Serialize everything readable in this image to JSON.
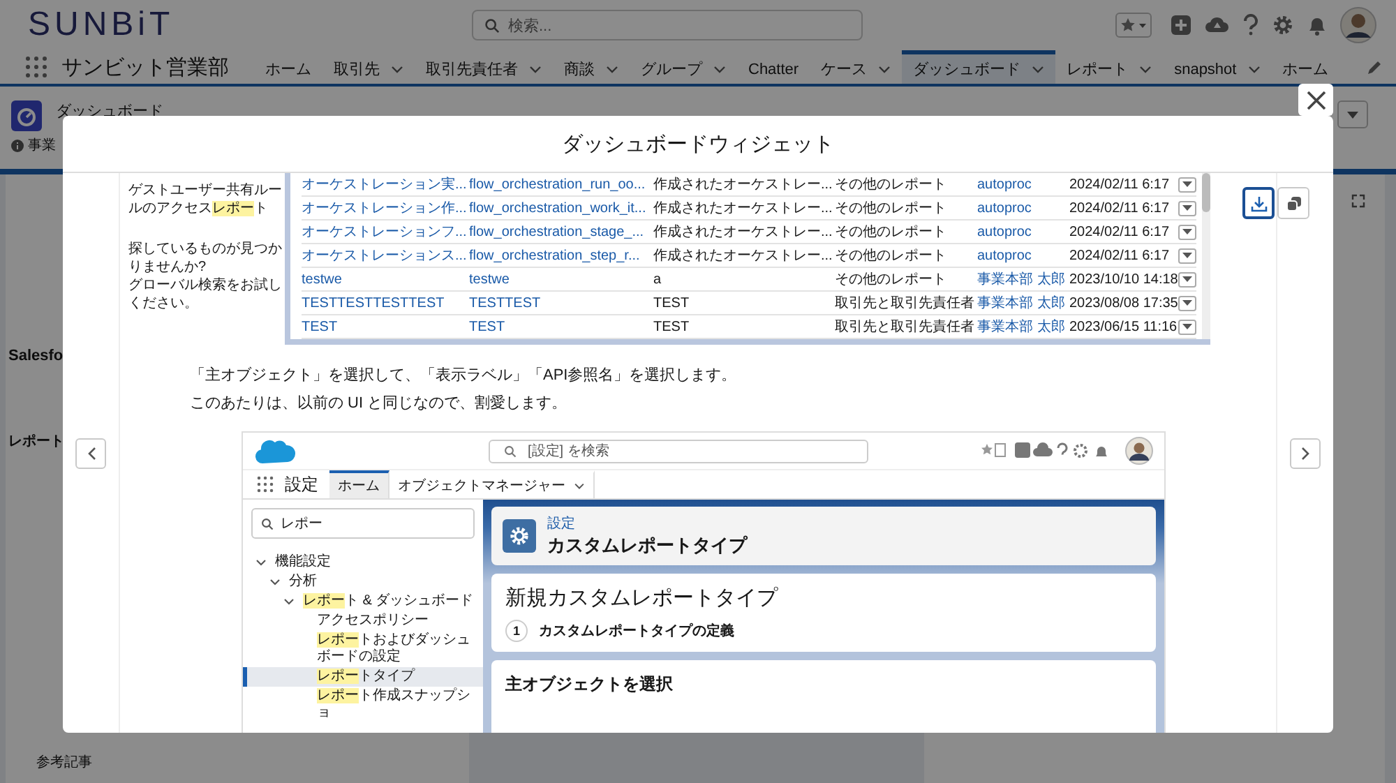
{
  "header": {
    "logo": "SUNBiT",
    "search_placeholder": "検索...",
    "app_name": "サンビット営業部",
    "nav": [
      {
        "label": "ホーム",
        "has_menu": false,
        "selected": false
      },
      {
        "label": "取引先",
        "has_menu": true,
        "selected": false
      },
      {
        "label": "取引先責任者",
        "has_menu": true,
        "selected": false
      },
      {
        "label": "商談",
        "has_menu": true,
        "selected": false
      },
      {
        "label": "グループ",
        "has_menu": true,
        "selected": false
      },
      {
        "label": "Chatter",
        "has_menu": false,
        "selected": false
      },
      {
        "label": "ケース",
        "has_menu": true,
        "selected": false
      },
      {
        "label": "ダッシュボード",
        "has_menu": true,
        "selected": true
      },
      {
        "label": "レポート",
        "has_menu": true,
        "selected": false
      },
      {
        "label": "snapshot",
        "has_menu": true,
        "selected": false
      },
      {
        "label": "ホーム",
        "has_menu": false,
        "selected": false
      }
    ]
  },
  "page": {
    "object_label": "ダッシュボード",
    "owner": "事業",
    "article_heading": "Salesfo",
    "section_heading": "レポート",
    "related_heading": "参考記事"
  },
  "modal": {
    "title": "ダッシュボードウィジェット",
    "tools": [
      {
        "kind": "download",
        "selected": true
      },
      {
        "kind": "copy",
        "selected": false
      }
    ],
    "article": {
      "sidebar_link": [
        {
          "text": "ゲストユーザー共有ルールのアクセス",
          "highlight": false
        },
        {
          "text": "レポー",
          "highlight": true
        },
        {
          "text": "ト",
          "highlight": false
        }
      ],
      "help_lines": [
        "探しているものが見つかりませんか?",
        "グローバル検索をお試しください。"
      ],
      "rows": [
        {
          "name": "オーケストレーション実...",
          "api_name": "flow_orchestration_run_oo...",
          "description": "作成されたオーケストレー...",
          "category": "その他のレポート",
          "creator": "autoproc",
          "date": "2024/02/11 6:17"
        },
        {
          "name": "オーケストレーション作...",
          "api_name": "flow_orchestration_work_it...",
          "description": "作成されたオーケストレー...",
          "category": "その他のレポート",
          "creator": "autoproc",
          "date": "2024/02/11 6:17"
        },
        {
          "name": "オーケストレーションフ...",
          "api_name": "flow_orchestration_stage_...",
          "description": "作成されたオーケストレー...",
          "category": "その他のレポート",
          "creator": "autoproc",
          "date": "2024/02/11 6:17"
        },
        {
          "name": "オーケストレーションス...",
          "api_name": "flow_orchestration_step_r...",
          "description": "作成されたオーケストレー...",
          "category": "その他のレポート",
          "creator": "autoproc",
          "date": "2024/02/11 6:17"
        },
        {
          "name": "testwe",
          "api_name": "testwe",
          "description": "a",
          "category": "その他のレポート",
          "creator": "事業本部 太郎",
          "date": "2023/10/10 14:18"
        },
        {
          "name": "TESTTESTTESTTEST",
          "api_name": "TESTTEST",
          "description": "TEST",
          "category": "取引先と取引先責任者",
          "creator": "事業本部 太郎",
          "date": "2023/08/08 17:35"
        },
        {
          "name": "TEST",
          "api_name": "TEST",
          "description": "TEST",
          "category": "取引先と取引先責任者",
          "creator": "事業本部 太郎",
          "date": "2023/06/15 11:16"
        }
      ],
      "paragraph": [
        "「主オブジェクト」を選択して、「表示ラベル」「API参照名」を選択します。",
        "このあたりは、以前の UI と同じなので、割愛します。"
      ],
      "embedded": {
        "search_placeholder": "[設定] を検索",
        "app_name": "設定",
        "tabs": [
          {
            "label": "ホーム",
            "has_menu": false,
            "selected": true
          },
          {
            "label": "オブジェクトマネージャー",
            "has_menu": true,
            "selected": false
          }
        ],
        "quick_find": "レポー",
        "tree": [
          {
            "segments": [
              {
                "text": "機能設定",
                "highlight": false
              }
            ],
            "expanded": true,
            "selected": false,
            "children": [
              {
                "segments": [
                  {
                    "text": "分析",
                    "highlight": false
                  }
                ],
                "expanded": true,
                "selected": false,
                "children": [
                  {
                    "segments": [
                      {
                        "text": "レポー",
                        "highlight": true
                      },
                      {
                        "text": "ト & ダッシュボード",
                        "highlight": false
                      }
                    ],
                    "expanded": true,
                    "selected": false,
                    "children": [
                      {
                        "segments": [
                          {
                            "text": "アクセスポリシー",
                            "highlight": false
                          }
                        ],
                        "selected": false
                      },
                      {
                        "segments": [
                          {
                            "text": "レポー",
                            "highlight": true
                          },
                          {
                            "text": "トおよびダッシュボードの設定",
                            "highlight": false
                          }
                        ],
                        "selected": false
                      },
                      {
                        "segments": [
                          {
                            "text": "レポー",
                            "highlight": true
                          },
                          {
                            "text": "トタイプ",
                            "highlight": false
                          }
                        ],
                        "selected": true
                      },
                      {
                        "segments": [
                          {
                            "text": "レポー",
                            "highlight": true
                          },
                          {
                            "text": "ト作成スナップショ",
                            "highlight": false
                          }
                        ],
                        "selected": false
                      }
                    ]
                  }
                ]
              }
            ]
          }
        ],
        "header_card": {
          "eyebrow": "設定",
          "title": "カスタムレポートタイプ"
        },
        "wizard": {
          "title": "新規カスタムレポートタイプ",
          "step_number": "1",
          "step_label": "カスタムレポートタイプの定義"
        },
        "section_title": "主オブジェクトを選択"
      }
    }
  }
}
